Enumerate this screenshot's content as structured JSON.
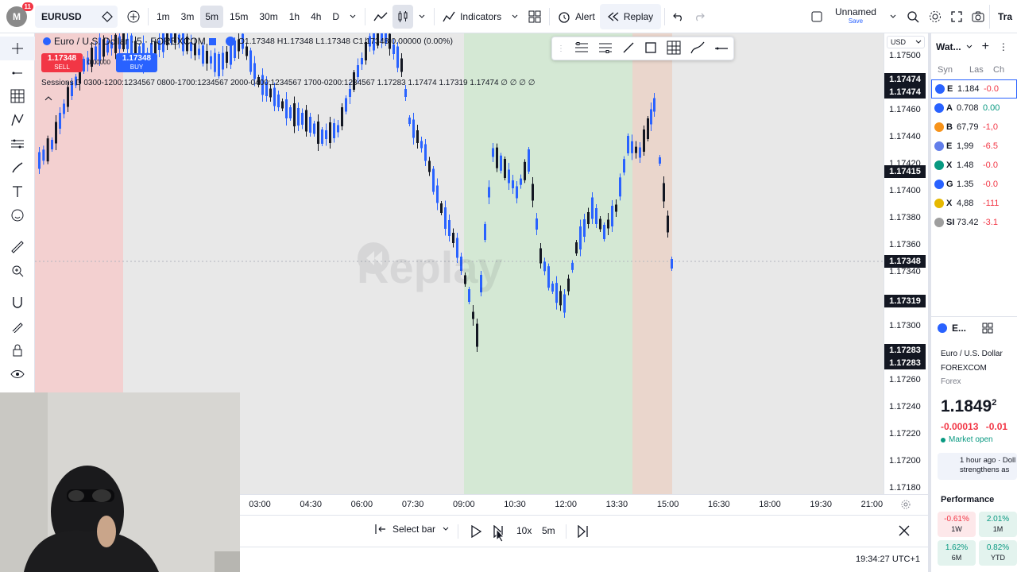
{
  "topbar": {
    "avatar_letter": "M",
    "avatar_badge": "11",
    "symbol": "EURUSD",
    "timeframes": [
      "1m",
      "3m",
      "5m",
      "15m",
      "30m",
      "1h",
      "4h",
      "D"
    ],
    "active_timeframe": "5m",
    "indicators_label": "Indicators",
    "alert_label": "Alert",
    "replay_label": "Replay",
    "layout_name": "Unnamed",
    "layout_save": "Save",
    "trade_label": "Tra"
  },
  "legend": {
    "title": "Euro / U.S. Dollar · 5 · FOREXCOM",
    "ohlc": "O1.17348 H1.17348 L1.17348 C1.17348 0.00000 (0.00%)",
    "sell_price": "1.17348",
    "sell_label": "SELL",
    "buy_price": "1.17348",
    "buy_label": "BUY",
    "spread": "0.00000",
    "session": "Sessions D 0300-1200:1234567 0800-1700:1234567 2000-0400:1234567 1700-0200:1234567  1.17283  1.17474  1.17319  1.17474  ∅  ∅  ∅  ∅",
    "watermark": "Replay"
  },
  "price_axis": {
    "currency": "USD",
    "ticks": [
      "1.17500",
      "1.17460",
      "1.17440",
      "1.17420",
      "1.17400",
      "1.17380",
      "1.17360",
      "1.17340",
      "1.17300",
      "1.17260",
      "1.17240",
      "1.17220",
      "1.17200",
      "1.17180"
    ],
    "labels": [
      {
        "text": "1.17474"
      },
      {
        "text": "1.17474"
      },
      {
        "text": "1.17415"
      },
      {
        "text": "1.17348"
      },
      {
        "text": "1.17319"
      },
      {
        "text": "1.17283"
      },
      {
        "text": "1.17283"
      }
    ]
  },
  "time_axis": {
    "ticks": [
      "03:00",
      "04:30",
      "06:00",
      "07:30",
      "09:00",
      "10:30",
      "12:00",
      "13:30",
      "15:00",
      "16:30",
      "18:00",
      "19:30",
      "21:00"
    ]
  },
  "replaybar": {
    "select_bar": "Select bar",
    "speed": "10x",
    "interval": "5m"
  },
  "status": {
    "clock": "19:34:27 UTC+1"
  },
  "watchlist": {
    "title": "Wat...",
    "col_symbol": "Syn",
    "col_last": "Las",
    "col_change": "Ch",
    "rows": [
      {
        "sym": "E",
        "last": "1.184",
        "chg": "-0.0",
        "color": "#2962ff"
      },
      {
        "sym": "A",
        "last": "0.708",
        "chg": "0.00",
        "color": "#2962ff"
      },
      {
        "sym": "B",
        "last": "67,79",
        "chg": "-1,0",
        "color": "#f7931a"
      },
      {
        "sym": "E",
        "last": "1,99",
        "chg": "-6.5",
        "color": "#627eea"
      },
      {
        "sym": "X",
        "last": "1.48",
        "chg": "-0.0",
        "color": "#089981"
      },
      {
        "sym": "G",
        "last": "1.35",
        "chg": "-0.0",
        "color": "#2962ff"
      },
      {
        "sym": "X",
        "last": "4,88",
        "chg": "-111",
        "color": "#e6b800"
      },
      {
        "sym": "SI",
        "last": "73.42",
        "chg": "-3.1",
        "color": "#9e9e9e"
      }
    ]
  },
  "details": {
    "short": "E...",
    "name": "Euro / U.S. Dollar",
    "exchange": "FOREXCOM",
    "type": "Forex",
    "price": "1.1849",
    "price_sup": "2",
    "change": "-0.00013",
    "change_pct": "-0.01",
    "market_status": "Market open",
    "news_time": "1 hour ago · Doll",
    "news_text": "strengthens as",
    "performance_label": "Performance",
    "perf": [
      {
        "val": "-0.61%",
        "period": "1W"
      },
      {
        "val": "2.01%",
        "period": "1M"
      },
      {
        "val": "1.62%",
        "period": "6M"
      },
      {
        "val": "0.82%",
        "period": "YTD"
      }
    ]
  },
  "colors": {
    "up": "#2962ff",
    "down": "#131722",
    "session_red": "#f3d0d0",
    "session_green": "#d4e8d4",
    "session_orange": "#ead6cc"
  }
}
